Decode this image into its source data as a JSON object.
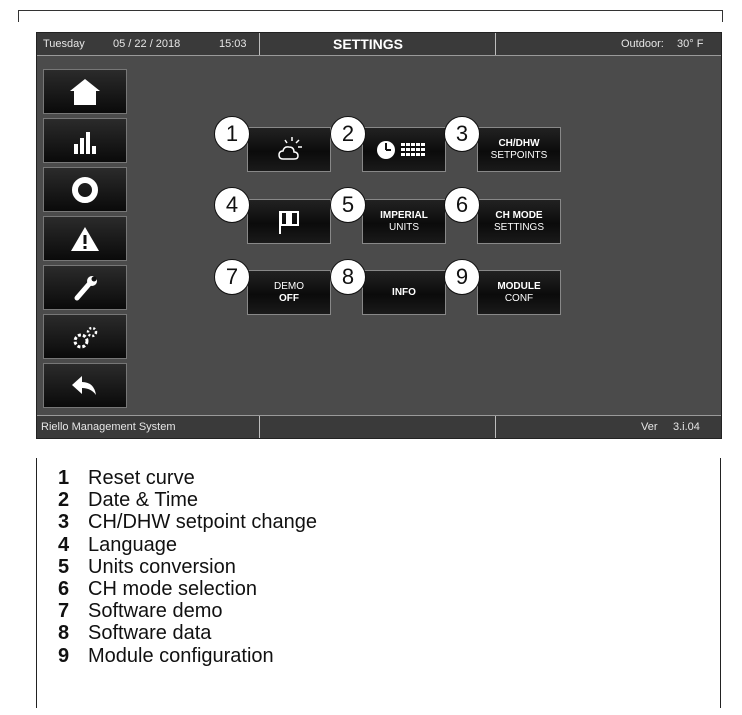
{
  "topbar": {
    "day": "Tuesday",
    "date": "05 / 22 / 2018",
    "time": "15:03",
    "title": "SETTINGS",
    "outdoor_label": "Outdoor:",
    "outdoor_value": "30° F"
  },
  "bottombar": {
    "system_name": "Riello Management System",
    "version_label": "Ver",
    "version_value": "3.i.04"
  },
  "sidebar": {
    "items": [
      {
        "icon": "home-icon"
      },
      {
        "icon": "bar-chart-icon"
      },
      {
        "icon": "ring-icon"
      },
      {
        "icon": "warning-icon"
      },
      {
        "icon": "wrench-icon"
      },
      {
        "icon": "gears-icon"
      },
      {
        "icon": "back-arrow-icon"
      }
    ]
  },
  "grid": {
    "b1": {
      "number": "1",
      "icon": "sun-cloud-icon"
    },
    "b2": {
      "number": "2",
      "icon": "clock-calendar-icon"
    },
    "b3": {
      "number": "3",
      "line1": "CH/DHW",
      "line2": "SETPOINTS"
    },
    "b4": {
      "number": "4",
      "icon": "flag-icon"
    },
    "b5": {
      "number": "5",
      "line1": "IMPERIAL",
      "line2": "UNITS"
    },
    "b6": {
      "number": "6",
      "line1": "CH MODE",
      "line2": "SETTINGS"
    },
    "b7": {
      "number": "7",
      "line1": "DEMO",
      "line2": "OFF"
    },
    "b8": {
      "number": "8",
      "line1": "INFO"
    },
    "b9": {
      "number": "9",
      "line1": "MODULE",
      "line2": "CONF"
    }
  },
  "legend": [
    {
      "key": "1",
      "text": "Reset curve"
    },
    {
      "key": "2",
      "text": "Date & Time"
    },
    {
      "key": "3",
      "text": "CH/DHW setpoint change"
    },
    {
      "key": "4",
      "text": "Language"
    },
    {
      "key": "5",
      "text": "Units conversion"
    },
    {
      "key": "6",
      "text": "CH mode selection"
    },
    {
      "key": "7",
      "text": "Software demo"
    },
    {
      "key": "8",
      "text": "Software data"
    },
    {
      "key": "9",
      "text": "Module configuration"
    }
  ],
  "colors": {
    "screen_bg": "#4b4b4b",
    "bar_bg": "#3a3a3a",
    "button_bg": "#0b0b0b"
  }
}
